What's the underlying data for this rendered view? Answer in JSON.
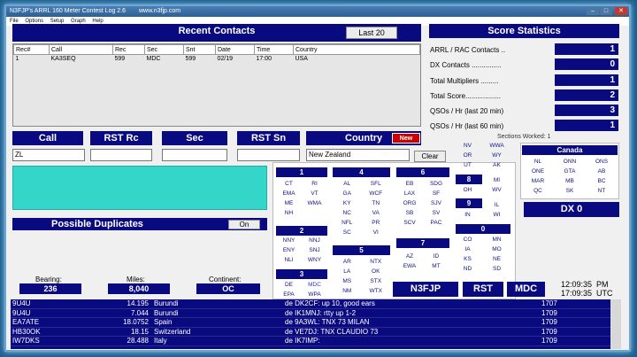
{
  "window": {
    "title": "N3FJP's ARRL 160 Meter Contest Log 2.6",
    "url": "www.n3fjp.com"
  },
  "menu": [
    "File",
    "Options",
    "Setup",
    "Graph",
    "Help"
  ],
  "recent": {
    "title": "Recent Contacts",
    "button": "Last 20",
    "headers": [
      "Rec#",
      "Call",
      "Rec",
      "Sec",
      "Snt",
      "Date",
      "Time",
      "Country"
    ],
    "rows": [
      [
        "1",
        "KA3SEQ",
        "599",
        "MDC",
        "599",
        "02/19",
        "17:00",
        "USA"
      ]
    ]
  },
  "score": {
    "title": "Score Statistics",
    "rows": [
      {
        "label": "ARRL / RAC Contacts ..",
        "value": "1"
      },
      {
        "label": "DX Contacts ...............",
        "value": "0"
      },
      {
        "label": "Total Multipliers .........",
        "value": "1"
      },
      {
        "label": "Total Score..................",
        "value": "2"
      },
      {
        "label": "QSOs / Hr (last 20 min)",
        "value": "3"
      },
      {
        "label": "QSOs / Hr (last 60 min)",
        "value": "1"
      }
    ],
    "sections_worked": "Sections Worked: 1"
  },
  "entry": {
    "call_label": "Call",
    "rst_rc_label": "RST Rc",
    "sec_label": "Sec",
    "rst_sn_label": "RST Sn",
    "country_label": "Country",
    "new_badge": "New",
    "call_value": "ZL",
    "country_value": "New Zealand",
    "clear": "Clear"
  },
  "dupes": {
    "title": "Possible Duplicates",
    "toggle": "On"
  },
  "bearing": {
    "bearing_label": "Bearing:",
    "bearing_value": "236",
    "miles_label": "Miles:",
    "miles_value": "8,040",
    "continent_label": "Continent:",
    "continent_value": "OC"
  },
  "sections": {
    "s1": {
      "title": "1",
      "items": [
        "CT",
        "RI",
        "EMA",
        "VT",
        "ME",
        "WMA",
        "NH",
        ""
      ]
    },
    "s2": {
      "title": "2",
      "items": [
        "NNY",
        "NNJ",
        "ENY",
        "SNJ",
        "NLI",
        "WNY"
      ]
    },
    "s3": {
      "title": "3",
      "items": [
        "DE",
        "MDC",
        "EPA",
        "WPA"
      ]
    },
    "s4": {
      "title": "4",
      "items": [
        "AL",
        "SFL",
        "GA",
        "WCF",
        "KY",
        "TN",
        "NC",
        "VA",
        "NFL",
        "PR",
        "SC",
        "VI"
      ]
    },
    "s5": {
      "title": "5",
      "items": [
        "AR",
        "NTX",
        "LA",
        "OK",
        "MS",
        "STX",
        "NM",
        "WTX"
      ]
    },
    "s6": {
      "title": "6",
      "items": [
        "EB",
        "SDG",
        "LAX",
        "SF",
        "ORG",
        "SJV",
        "SB",
        "SV",
        "SCV",
        "PAC"
      ]
    },
    "s7": {
      "title": "7",
      "items": [
        "AZ",
        "ID",
        "EWA",
        "MT"
      ]
    },
    "s7top": {
      "items": [
        "NV",
        "WWA",
        "OR",
        "WY",
        "UT",
        "AK"
      ]
    },
    "s8": {
      "title": "8",
      "items": [
        "MI",
        "OH",
        "WV"
      ]
    },
    "s9": {
      "title": "9",
      "items": [
        "IL",
        "IN",
        "WI"
      ]
    },
    "s0": {
      "title": "0",
      "items": [
        "CO",
        "MN",
        "IA",
        "MO",
        "KS",
        "NE",
        "ND",
        "SD"
      ]
    },
    "canada": {
      "title": "Canada",
      "items": [
        "NL",
        "ONN",
        "ONS",
        "ONE",
        "GTA",
        "AB",
        "MAR",
        "MB",
        "BC",
        "QC",
        "SK",
        "NT"
      ]
    }
  },
  "dx": {
    "label": "DX  0"
  },
  "station": {
    "call": "N3FJP",
    "rst": "RST",
    "sec": "MDC",
    "time_pm": "12:09:35  PM",
    "time_utc": "17:09:35  UTC"
  },
  "spots": [
    [
      "9U4U",
      "14.195",
      "Burundi",
      "de DK2CF:  up 10, good ears",
      "1707"
    ],
    [
      "9U4U",
      "7.044",
      "Burundi",
      "de IK1MNJ:  rtty up 1-2",
      "1709"
    ],
    [
      "EA7ATE",
      "18.0752",
      "Spain",
      "de 9A3WL:  TNX 73 MILAN",
      "1709"
    ],
    [
      "HB30OK",
      "18.15",
      "Switzerland",
      "de VE7DJ:  TNX CLAUDIO 73",
      "1709"
    ],
    [
      "IW7DKS",
      "28.488",
      "Italy",
      "de IK7IMP:",
      "1709"
    ]
  ],
  "colors": {
    "navy": "#0a0a80",
    "teal": "#33d6c9",
    "red": "#cc0000"
  }
}
